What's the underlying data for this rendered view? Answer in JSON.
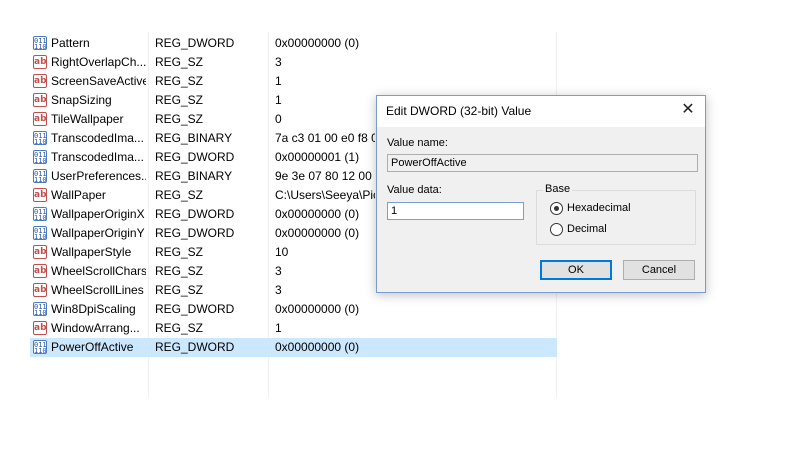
{
  "registry": {
    "rows": [
      {
        "name": "Pattern",
        "type": "REG_DWORD",
        "data": "0x00000000 (0)",
        "kind": "dword"
      },
      {
        "name": "RightOverlapCh...",
        "type": "REG_SZ",
        "data": "3",
        "kind": "sz"
      },
      {
        "name": "ScreenSaveActive",
        "type": "REG_SZ",
        "data": "1",
        "kind": "sz"
      },
      {
        "name": "SnapSizing",
        "type": "REG_SZ",
        "data": "1",
        "kind": "sz"
      },
      {
        "name": "TileWallpaper",
        "type": "REG_SZ",
        "data": "0",
        "kind": "sz"
      },
      {
        "name": "TranscodedIma...",
        "type": "REG_BINARY",
        "data": "7a c3 01 00 e0 f8 02",
        "kind": "dword"
      },
      {
        "name": "TranscodedIma...",
        "type": "REG_DWORD",
        "data": "0x00000001 (1)",
        "kind": "dword"
      },
      {
        "name": "UserPreferences...",
        "type": "REG_BINARY",
        "data": "9e 3e 07 80 12 00 00",
        "kind": "dword"
      },
      {
        "name": "WallPaper",
        "type": "REG_SZ",
        "data": "C:\\Users\\Seeya\\Pict",
        "kind": "sz"
      },
      {
        "name": "WallpaperOriginX",
        "type": "REG_DWORD",
        "data": "0x00000000 (0)",
        "kind": "dword"
      },
      {
        "name": "WallpaperOriginY",
        "type": "REG_DWORD",
        "data": "0x00000000 (0)",
        "kind": "dword"
      },
      {
        "name": "WallpaperStyle",
        "type": "REG_SZ",
        "data": "10",
        "kind": "sz"
      },
      {
        "name": "WheelScrollChars",
        "type": "REG_SZ",
        "data": "3",
        "kind": "sz"
      },
      {
        "name": "WheelScrollLines",
        "type": "REG_SZ",
        "data": "3",
        "kind": "sz"
      },
      {
        "name": "Win8DpiScaling",
        "type": "REG_DWORD",
        "data": "0x00000000 (0)",
        "kind": "dword"
      },
      {
        "name": "WindowArrang...",
        "type": "REG_SZ",
        "data": "1",
        "kind": "sz"
      },
      {
        "name": "PowerOffActive",
        "type": "REG_DWORD",
        "data": "0x00000000 (0)",
        "kind": "dword",
        "selected": true
      }
    ],
    "icons": {
      "dword": "binary-value-icon",
      "sz": "string-value-icon"
    },
    "selected_color": "#cce8ff"
  },
  "dialog": {
    "title": "Edit DWORD (32-bit) Value",
    "close_glyph": "✕",
    "value_name_label": "Value name:",
    "value_name": "PowerOffActive",
    "value_data_label": "Value data:",
    "value_data": "1",
    "base_label": "Base",
    "base_options": [
      "Hexadecimal",
      "Decimal"
    ],
    "base_selected": "Hexadecimal",
    "ok_label": "OK",
    "cancel_label": "Cancel",
    "accent_color": "#0078d7"
  }
}
